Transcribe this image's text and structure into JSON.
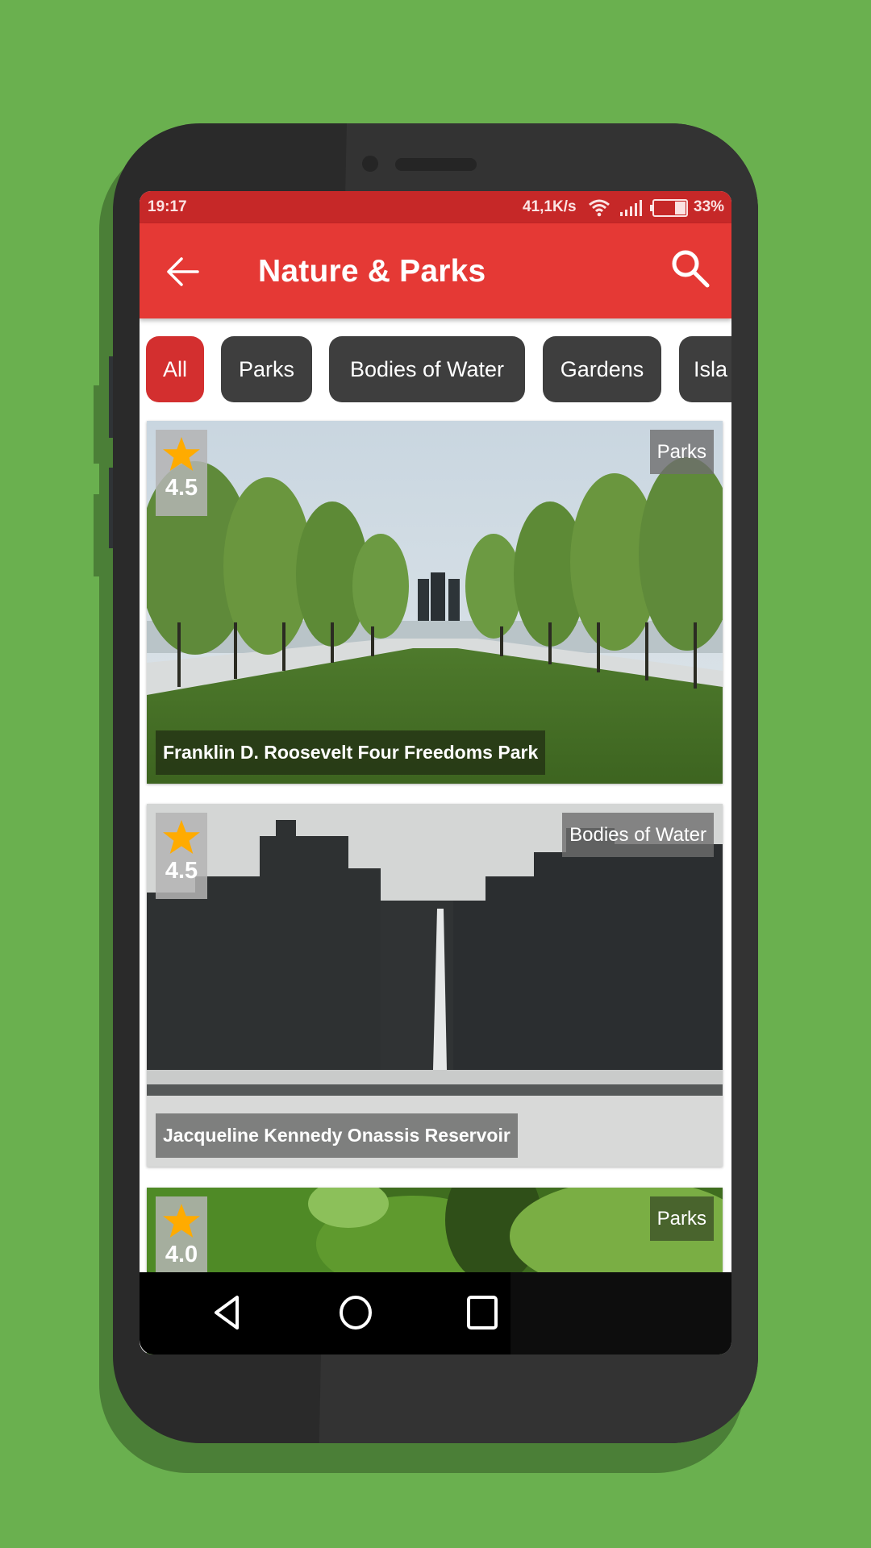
{
  "status_bar": {
    "time": "19:17",
    "network_speed": "41,1K/s",
    "wifi_icon": "wifi-icon",
    "signal_icon": "signal-icon",
    "battery_icon": "battery-icon",
    "battery_percent": "33%",
    "battery_level": 0.33
  },
  "app_bar": {
    "back_icon": "arrow-left-icon",
    "title": "Nature & Parks",
    "search_icon": "search-icon"
  },
  "filters": [
    {
      "label": "All",
      "active": true
    },
    {
      "label": "Parks",
      "active": false
    },
    {
      "label": "Bodies of Water",
      "active": false
    },
    {
      "label": "Gardens",
      "active": false
    },
    {
      "label": "Isla",
      "active": false
    }
  ],
  "places": [
    {
      "name": "Franklin D. Roosevelt Four Freedoms Park",
      "category": "Parks",
      "rating": "4.5",
      "star_icon": "star-icon"
    },
    {
      "name": "Jacqueline Kennedy Onassis Reservoir",
      "category": "Bodies of Water",
      "rating": "4.5",
      "star_icon": "star-icon"
    },
    {
      "name": "",
      "category": "Parks",
      "rating": "4.0",
      "star_icon": "star-icon"
    }
  ],
  "nav_bar": {
    "back": "nav-back-icon",
    "home": "nav-home-icon",
    "recents": "nav-recents-icon"
  },
  "colors": {
    "background": "#6ab04f",
    "status_bar": "#c62828",
    "app_bar": "#e53935",
    "chip_active": "#d32f2f",
    "chip_inactive": "#3e3e3e",
    "star": "#ffab00"
  }
}
